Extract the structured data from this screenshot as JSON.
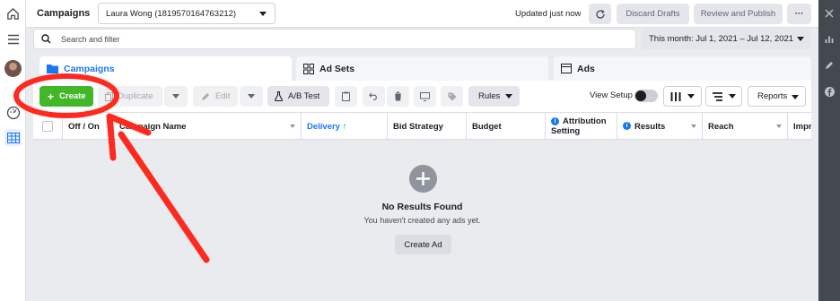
{
  "header": {
    "title": "Campaigns",
    "account": "Laura Wong (1819570164763212)",
    "updated": "Updated just now",
    "discard": "Discard Drafts",
    "review": "Review and Publish",
    "more": "···"
  },
  "search": {
    "placeholder": "Search and filter"
  },
  "date_range": "This month: Jul 1, 2021 – Jul 12, 2021",
  "tabs": [
    {
      "label": "Campaigns",
      "icon": "folder-icon"
    },
    {
      "label": "Ad Sets",
      "icon": "grid-icon"
    },
    {
      "label": "Ads",
      "icon": "ad-window-icon"
    }
  ],
  "toolbar": {
    "create": "Create",
    "duplicate": "Duplicate",
    "edit": "Edit",
    "ab_test": "A/B Test",
    "rules": "Rules",
    "view_setup": "View Setup",
    "reports": "Reports"
  },
  "columns": [
    "Off / On",
    "Campaign Name",
    "Delivery ↑",
    "Bid Strategy",
    "Budget",
    "Attribution Setting",
    "Results",
    "Reach",
    "Impr"
  ],
  "empty_state": {
    "title": "No Results Found",
    "subtitle": "You haven't created any ads yet.",
    "button": "Create Ad"
  },
  "colors": {
    "accent": "#1877f2",
    "create_green": "#42b72a",
    "annotation_red": "#ff2a1f"
  }
}
